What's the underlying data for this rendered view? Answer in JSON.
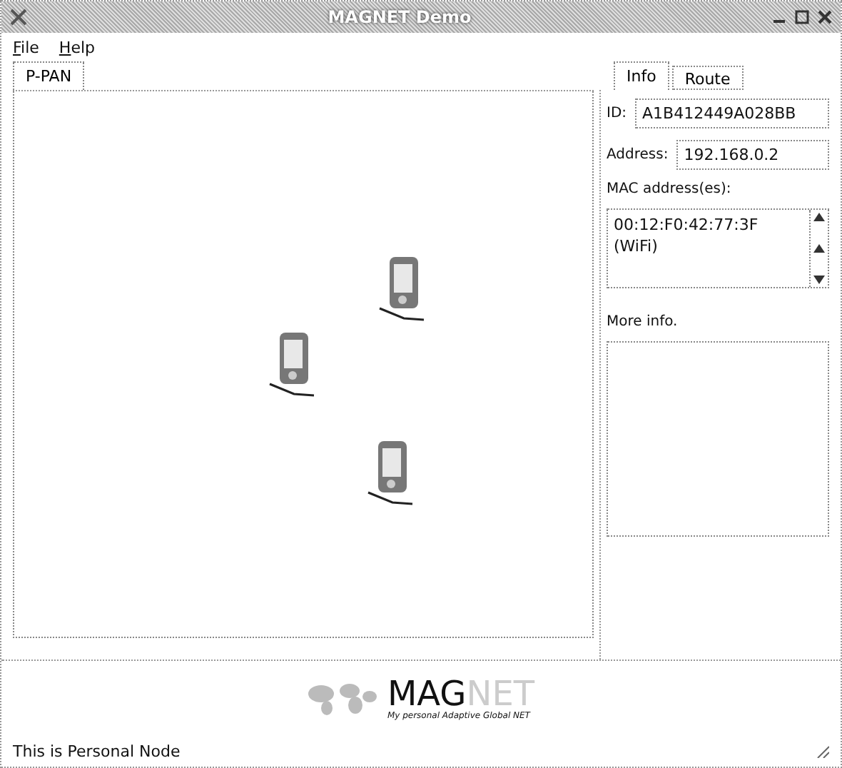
{
  "window": {
    "title": "MAGNET Demo"
  },
  "menu": [
    {
      "label": "File"
    },
    {
      "label": "Help"
    }
  ],
  "left_tabs": [
    {
      "label": "P-PAN",
      "selected": true
    }
  ],
  "right_tabs": [
    {
      "label": "Info",
      "selected": true
    },
    {
      "label": "Route",
      "selected": false
    }
  ],
  "info": {
    "id_label": "ID:",
    "id_value": "A1B412449A028BB",
    "address_label": "Address:",
    "address_value": "192.168.0.2",
    "mac_label": "MAC address(es):",
    "mac_lines": [
      "00:12:F0:42:77:3F",
      "(WiFi)"
    ],
    "more_label": "More info."
  },
  "logo": {
    "dark": "MAG",
    "light": "NET",
    "tagline": "My personal Adaptive Global NET"
  },
  "status_bar": "This is Personal Node"
}
